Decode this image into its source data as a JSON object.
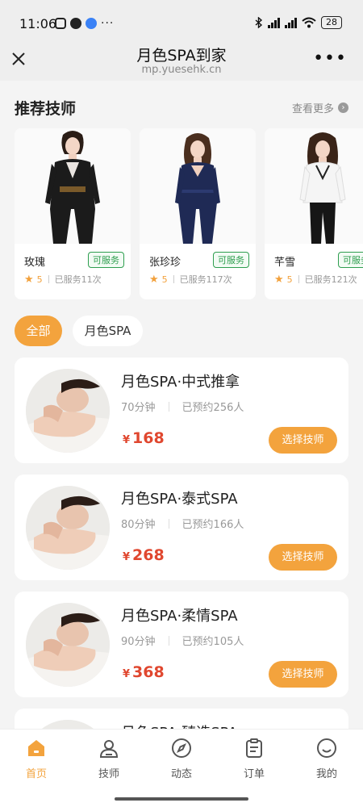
{
  "status_bar": {
    "time": "11:06",
    "battery": "28"
  },
  "nav": {
    "title": "月色SPA到家",
    "url": "mp.yuesehk.cn"
  },
  "recommend": {
    "title": "推荐技师",
    "more": "查看更多",
    "technicians": [
      {
        "name": "玫瑰",
        "status": "可服务",
        "rating": "5",
        "served": "已服务11次",
        "outfit": "#1b1b1b"
      },
      {
        "name": "张珍珍",
        "status": "可服务",
        "rating": "5",
        "served": "已服务117次",
        "outfit": "#1f2a55"
      },
      {
        "name": "芊雪",
        "status": "可服务",
        "rating": "5",
        "served": "已服务121次",
        "outfit": "#f5f5f5"
      }
    ]
  },
  "categories": [
    {
      "label": "全部",
      "active": true
    },
    {
      "label": "月色SPA",
      "active": false
    }
  ],
  "services": [
    {
      "name": "月色SPA·中式推拿",
      "duration": "70分钟",
      "booked": "已预约256人",
      "currency": "¥",
      "price": "168",
      "button": "选择技师"
    },
    {
      "name": "月色SPA·泰式SPA",
      "duration": "80分钟",
      "booked": "已预约166人",
      "currency": "¥",
      "price": "268",
      "button": "选择技师"
    },
    {
      "name": "月色SPA·柔情SPA",
      "duration": "90分钟",
      "booked": "已预约105人",
      "currency": "¥",
      "price": "368",
      "button": "选择技师"
    },
    {
      "name": "月色SPA·臻选SPA"
    }
  ],
  "tabbar": {
    "accent": "#f3a33d",
    "items": [
      {
        "label": "首页",
        "icon": "home-icon",
        "active": true
      },
      {
        "label": "技师",
        "icon": "person-icon",
        "active": false
      },
      {
        "label": "动态",
        "icon": "compass-icon",
        "active": false
      },
      {
        "label": "订单",
        "icon": "clipboard-icon",
        "active": false
      },
      {
        "label": "我的",
        "icon": "smile-icon",
        "active": false
      }
    ]
  }
}
